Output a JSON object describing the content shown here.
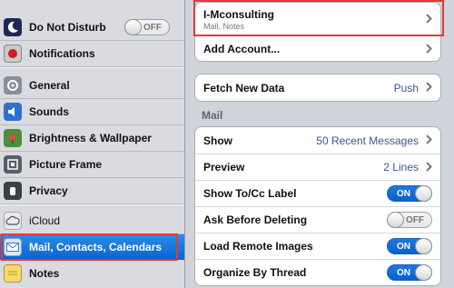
{
  "sidebar": {
    "items": [
      {
        "label": "Do Not Disturb",
        "icon": "moon-icon",
        "toggle": "OFF"
      },
      {
        "label": "Notifications",
        "icon": "notifications-icon"
      },
      {
        "label": "General",
        "icon": "gear-icon"
      },
      {
        "label": "Sounds",
        "icon": "speaker-icon"
      },
      {
        "label": "Brightness & Wallpaper",
        "icon": "flower-icon"
      },
      {
        "label": "Picture Frame",
        "icon": "picture-frame-icon"
      },
      {
        "label": "Privacy",
        "icon": "hand-icon"
      },
      {
        "label": "iCloud",
        "icon": "cloud-icon"
      },
      {
        "label": "Mail, Contacts, Calendars",
        "icon": "mail-icon"
      },
      {
        "label": "Notes",
        "icon": "notes-icon"
      }
    ],
    "selected_index": 8
  },
  "accounts": {
    "account_name": "I-Mconsulting",
    "account_sub": "Mail, Notes",
    "add_account": "Add Account..."
  },
  "fetch": {
    "label": "Fetch New Data",
    "value": "Push"
  },
  "mail": {
    "section_title": "Mail",
    "show_label": "Show",
    "show_value": "50 Recent Messages",
    "preview_label": "Preview",
    "preview_value": "2 Lines",
    "tocc_label": "Show To/Cc Label",
    "tocc_state": "ON",
    "ask_label": "Ask Before Deleting",
    "ask_state": "OFF",
    "images_label": "Load Remote Images",
    "images_state": "ON",
    "thread_label": "Organize By Thread",
    "thread_state": "ON"
  },
  "colors": {
    "selection": "#0a63d0",
    "highlight_border": "#e03a3a",
    "toggle_on": "#1f7ae0",
    "value_text": "#3a5795"
  }
}
